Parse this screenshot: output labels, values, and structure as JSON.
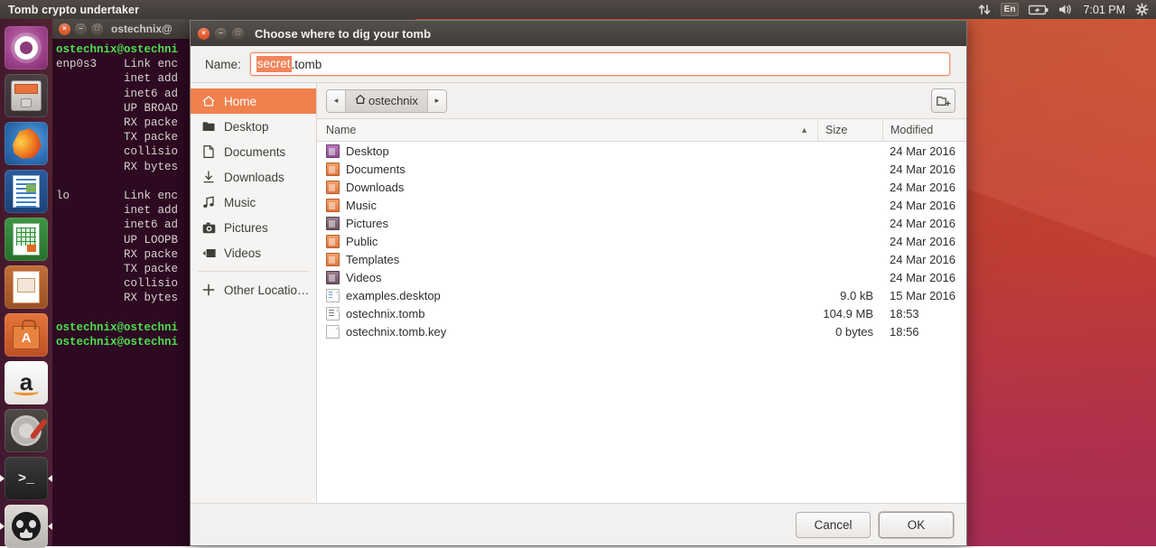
{
  "top_panel": {
    "app_title": "Tomb crypto undertaker",
    "tray": {
      "network_icon": "network-updown-icon",
      "keyboard_layout": "En",
      "battery_icon": "battery-icon",
      "volume_icon": "volume-icon",
      "clock": "7:01 PM",
      "session_icon": "gear-session-icon"
    }
  },
  "launcher": {
    "items": [
      {
        "name": "ubuntu-dash",
        "label": "Dash home"
      },
      {
        "name": "files",
        "label": "Files"
      },
      {
        "name": "firefox",
        "label": "Firefox Web Browser"
      },
      {
        "name": "libreoffice-writer",
        "label": "LibreOffice Writer"
      },
      {
        "name": "libreoffice-calc",
        "label": "LibreOffice Calc"
      },
      {
        "name": "libreoffice-impress",
        "label": "LibreOffice Impress"
      },
      {
        "name": "ubuntu-software",
        "label": "Ubuntu Software"
      },
      {
        "name": "amazon",
        "label": "Amazon"
      },
      {
        "name": "system-settings",
        "label": "System Settings"
      },
      {
        "name": "terminal",
        "label": "Terminal"
      },
      {
        "name": "tomb",
        "label": "Tomb"
      }
    ]
  },
  "terminal": {
    "title": "ostechnix@",
    "lines": [
      {
        "text": "ostechnix@ostechni",
        "prompt": true
      },
      {
        "text": "enp0s3    Link enc"
      },
      {
        "text": "          inet add"
      },
      {
        "text": "          inet6 ad"
      },
      {
        "text": "          UP BROAD"
      },
      {
        "text": "          RX packe"
      },
      {
        "text": "          TX packe"
      },
      {
        "text": "          collisio"
      },
      {
        "text": "          RX bytes"
      },
      {
        "text": ""
      },
      {
        "text": "lo        Link enc"
      },
      {
        "text": "          inet add"
      },
      {
        "text": "          inet6 ad"
      },
      {
        "text": "          UP LOOPB"
      },
      {
        "text": "          RX packe"
      },
      {
        "text": "          TX packe"
      },
      {
        "text": "          collisio"
      },
      {
        "text": "          RX bytes"
      },
      {
        "text": ""
      },
      {
        "text": "ostechnix@ostechni",
        "prompt": true
      },
      {
        "text": "ostechnix@ostechni",
        "prompt": true
      }
    ]
  },
  "dialog": {
    "title": "Choose where to dig your tomb",
    "window_buttons": {
      "close": "×",
      "minimize": "−",
      "maximize": "□"
    },
    "name_label": "Name:",
    "filename": {
      "selected": "secret",
      "rest": ".tomb",
      "full": "secret.tomb"
    },
    "places": [
      {
        "label": "Home",
        "icon": "home-icon",
        "active": true
      },
      {
        "label": "Desktop",
        "icon": "desktop-folder-icon",
        "active": false
      },
      {
        "label": "Documents",
        "icon": "document-icon",
        "active": false
      },
      {
        "label": "Downloads",
        "icon": "download-icon",
        "active": false
      },
      {
        "label": "Music",
        "icon": "music-icon",
        "active": false
      },
      {
        "label": "Pictures",
        "icon": "camera-icon",
        "active": false
      },
      {
        "label": "Videos",
        "icon": "video-icon",
        "active": false
      },
      {
        "label": "Other Locatio…",
        "icon": "plus-icon",
        "active": false
      }
    ],
    "pathbar": {
      "back_arrow": "◂",
      "forward_arrow": "▸",
      "crumb_icon": "home-icon",
      "crumb_label": "ostechnix",
      "new_folder_icon": "new-folder-icon"
    },
    "columns": {
      "name": "Name",
      "size": "Size",
      "modified": "Modified",
      "sort_arrow": "▲"
    },
    "files": [
      {
        "name": "Desktop",
        "type": "folder",
        "variant": "purple",
        "size": "",
        "modified": "24 Mar 2016"
      },
      {
        "name": "Documents",
        "type": "folder",
        "variant": "",
        "size": "",
        "modified": "24 Mar 2016"
      },
      {
        "name": "Downloads",
        "type": "folder",
        "variant": "",
        "size": "",
        "modified": "24 Mar 2016"
      },
      {
        "name": "Music",
        "type": "folder",
        "variant": "",
        "size": "",
        "modified": "24 Mar 2016"
      },
      {
        "name": "Pictures",
        "type": "folder",
        "variant": "dark",
        "size": "",
        "modified": "24 Mar 2016"
      },
      {
        "name": "Public",
        "type": "folder",
        "variant": "",
        "size": "",
        "modified": "24 Mar 2016"
      },
      {
        "name": "Templates",
        "type": "folder",
        "variant": "",
        "size": "",
        "modified": "24 Mar 2016"
      },
      {
        "name": "Videos",
        "type": "folder",
        "variant": "dark",
        "size": "",
        "modified": "24 Mar 2016"
      },
      {
        "name": "examples.desktop",
        "type": "file",
        "variant": "lines",
        "size": "9.0 kB",
        "modified": "15 Mar 2016"
      },
      {
        "name": "ostechnix.tomb",
        "type": "file",
        "variant": "nums",
        "size": "104.9 MB",
        "modified": "18:53"
      },
      {
        "name": "ostechnix.tomb.key",
        "type": "file",
        "variant": "",
        "size": "0 bytes",
        "modified": "18:56"
      }
    ],
    "buttons": {
      "cancel": "Cancel",
      "ok": "OK"
    }
  },
  "colors": {
    "accent_orange": "#f0814d",
    "selection_orange": "#f0845a",
    "panel_dark": "#403a36",
    "terminal_bg": "#2d0922",
    "terminal_prompt_green": "#4de04d",
    "wallpaper_top": "#d8512a",
    "wallpaper_bottom": "#b52f5c"
  }
}
